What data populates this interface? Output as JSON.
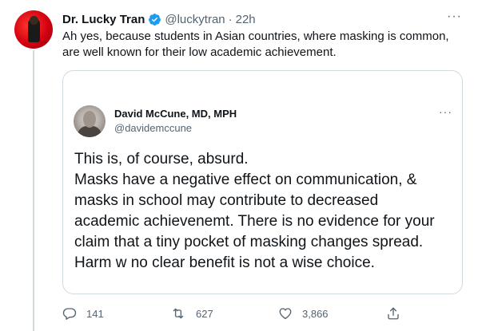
{
  "tweet": {
    "author_name": "Dr. Lucky Tran",
    "author_handle": "@luckytran",
    "separator": "·",
    "time": "22h",
    "more": "···",
    "text": "Ah yes, because students in Asian countries, where masking is common, are well known for their low academic achievement."
  },
  "quoted_tweet": {
    "author_name": "David McCune, MD, MPH",
    "author_handle": "@davidemccune",
    "more": "···",
    "lines": [
      "This is, of course, absurd.",
      "Masks have a negative effect on communication, &",
      "masks in school may contribute to decreased",
      "academic achievenemt. There is no evidence for your",
      "claim that a tiny pocket of masking changes spread.",
      "Harm w no clear benefit is not a wise choice."
    ]
  },
  "actions": {
    "reply_count": "141",
    "retweet_count": "627",
    "like_count": "3,866"
  },
  "colors": {
    "text": "#0f1419",
    "secondary": "#536471",
    "border": "#cfd9de",
    "verified": "#1d9bf0"
  },
  "icons": [
    "verified-badge-icon",
    "more-icon",
    "reply-icon",
    "retweet-icon",
    "like-icon",
    "share-icon"
  ]
}
